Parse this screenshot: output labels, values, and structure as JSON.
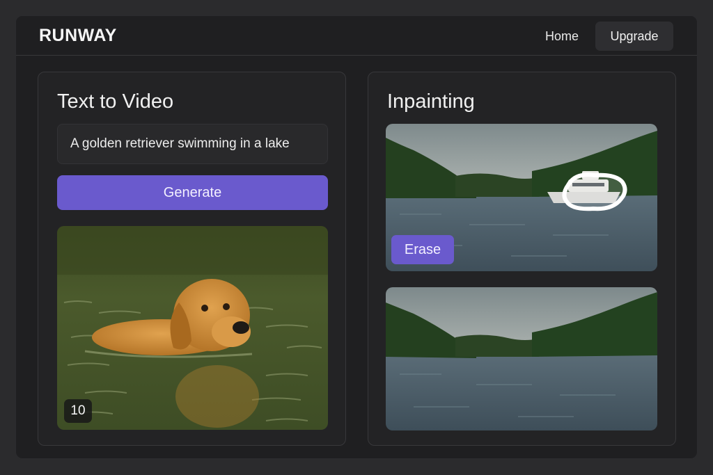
{
  "app": {
    "brand": "RUNWAY"
  },
  "nav": {
    "home": "Home",
    "upgrade": "Upgrade"
  },
  "text_to_video": {
    "title": "Text to Video",
    "prompt": "A golden retriever swimming in a lake",
    "generate_label": "Generate",
    "preview_badge": "10"
  },
  "inpainting": {
    "title": "Inpainting",
    "erase_label": "Erase"
  },
  "colors": {
    "accent": "#6a5acd",
    "background": "#2b2b2d",
    "panel": "#232325"
  }
}
